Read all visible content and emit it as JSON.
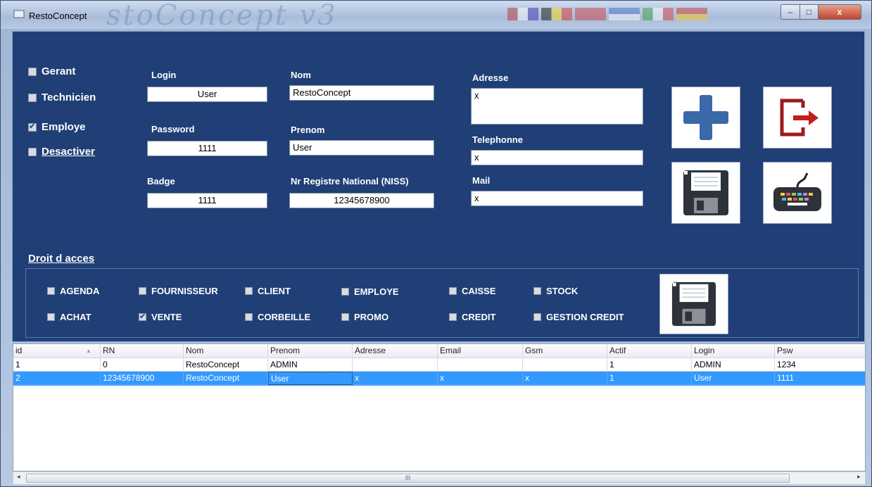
{
  "window": {
    "title": "RestoConcept",
    "watermark": "stoConcept v3",
    "minimize": "–",
    "maximize": "□",
    "close": "x"
  },
  "roles": [
    {
      "label": "Gerant",
      "checked": false
    },
    {
      "label": "Technicien",
      "checked": false
    },
    {
      "label": "Employe",
      "checked": true
    },
    {
      "label": "Desactiver",
      "checked": false
    }
  ],
  "fields": {
    "login_label": "Login",
    "login_value": "User",
    "password_label": "Password",
    "password_value": "1111",
    "badge_label": "Badge",
    "badge_value": "1111",
    "nom_label": "Nom",
    "nom_value": "RestoConcept",
    "prenom_label": "Prenom",
    "prenom_value": "User",
    "niss_label": "Nr Registre National (NISS)",
    "niss_value": "12345678900",
    "adresse_label": "Adresse",
    "adresse_value": "x",
    "telephone_label": "Telephonne",
    "telephone_value": "x",
    "mail_label": "Mail",
    "mail_value": "x"
  },
  "actions": {
    "add": "plus-icon",
    "exit": "exit-icon",
    "save": "floppy-disk-icon",
    "keyboard": "keyboard-icon"
  },
  "rights": {
    "title": "Droit d acces",
    "items": [
      {
        "label": "AGENDA",
        "checked": false
      },
      {
        "label": "FOURNISSEUR",
        "checked": false
      },
      {
        "label": "CLIENT",
        "checked": false
      },
      {
        "label": "EMPLOYE",
        "checked": false
      },
      {
        "label": "CAISSE",
        "checked": false
      },
      {
        "label": "STOCK",
        "checked": false
      },
      {
        "label": "ACHAT",
        "checked": false
      },
      {
        "label": "VENTE",
        "checked": true
      },
      {
        "label": "CORBEILLE",
        "checked": false
      },
      {
        "label": "PROMO",
        "checked": false
      },
      {
        "label": "CREDIT",
        "checked": false
      },
      {
        "label": "GESTION CREDIT",
        "checked": false
      }
    ]
  },
  "grid": {
    "columns": [
      "id",
      "RN",
      "Nom",
      "Prenom",
      "Adresse",
      "Email",
      "Gsm",
      "Actif",
      "Login",
      "Psw"
    ],
    "rows": [
      [
        "1",
        "0",
        "RestoConcept",
        "ADMIN",
        "",
        "",
        "",
        "1",
        "ADMIN",
        "1234"
      ],
      [
        "2",
        "12345678900",
        "RestoConcept",
        "User",
        "x",
        "x",
        "x",
        "1",
        "User",
        "1111"
      ]
    ],
    "selected_row": 1,
    "sort_column": "id"
  },
  "scrollbar": {
    "left": "◂",
    "right": "▸",
    "grip": "III"
  },
  "colors": {
    "panel": "#1f3f76",
    "selection": "#3399ff",
    "accent_blue": "#3a68a8",
    "accent_red": "#b21a1a"
  }
}
